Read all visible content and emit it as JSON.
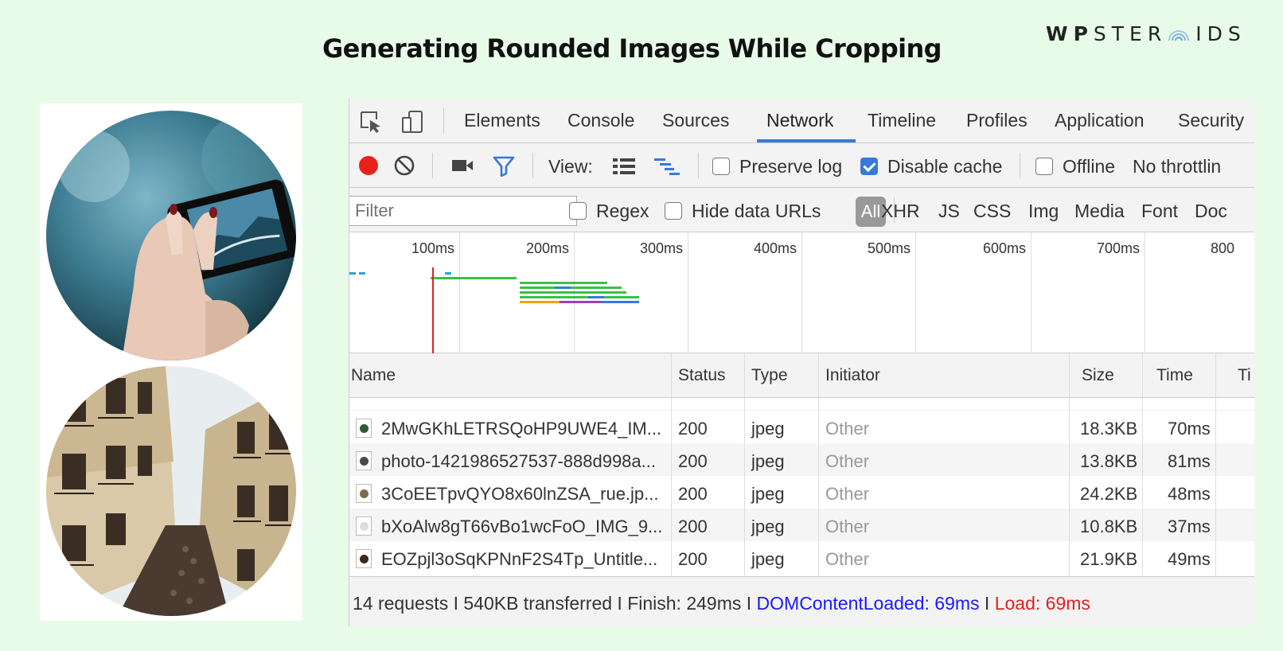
{
  "page_title": "Generating Rounded Images While Cropping",
  "brand": {
    "part1": "WP",
    "part2": "STER",
    "part3": "IDS"
  },
  "devtools": {
    "tabs": [
      {
        "label": "Elements"
      },
      {
        "label": "Console"
      },
      {
        "label": "Sources"
      },
      {
        "label": "Network",
        "active": true
      },
      {
        "label": "Timeline"
      },
      {
        "label": "Profiles"
      },
      {
        "label": "Application"
      },
      {
        "label": "Security"
      }
    ],
    "toolbar": {
      "view_label": "View:",
      "preserve_log": "Preserve log",
      "disable_cache": "Disable cache",
      "offline": "Offline",
      "throttling": "No throttlin"
    },
    "filter": {
      "placeholder": "Filter",
      "regex": "Regex",
      "hide_data_urls": "Hide data URLs",
      "all": "All",
      "types": [
        "XHR",
        "JS",
        "CSS",
        "Img",
        "Media",
        "Font",
        "Doc"
      ]
    },
    "overview_ticks": [
      "100ms",
      "200ms",
      "300ms",
      "400ms",
      "500ms",
      "600ms",
      "700ms",
      "800"
    ],
    "columns": {
      "name": "Name",
      "status": "Status",
      "type": "Type",
      "initiator": "Initiator",
      "size": "Size",
      "time": "Time",
      "timeline": "Ti"
    },
    "rows": [
      {
        "name": "2MwGKhLETRSQoHP9UWE4_IM...",
        "status": "200",
        "type": "jpeg",
        "initiator": "Other",
        "size": "18.3KB",
        "time": "70ms",
        "thumb_color": "#2f5a3a"
      },
      {
        "name": "photo-1421986527537-888d998a...",
        "status": "200",
        "type": "jpeg",
        "initiator": "Other",
        "size": "13.8KB",
        "time": "81ms",
        "thumb_color": "#4a4a4a"
      },
      {
        "name": "3CoEETpvQYO8x60lnZSA_rue.jp...",
        "status": "200",
        "type": "jpeg",
        "initiator": "Other",
        "size": "24.2KB",
        "time": "48ms",
        "thumb_color": "#7a6a50"
      },
      {
        "name": "bXoAlw8gT66vBo1wcFoO_IMG_9...",
        "status": "200",
        "type": "jpeg",
        "initiator": "Other",
        "size": "10.8KB",
        "time": "37ms",
        "thumb_color": "#d8dde0"
      },
      {
        "name": "EOZpjl3oSqKPNnF2S4Tp_Untitle...",
        "status": "200",
        "type": "jpeg",
        "initiator": "Other",
        "size": "21.9KB",
        "time": "49ms",
        "thumb_color": "#3a2a20"
      }
    ],
    "status": {
      "summary": "14 requests I 540KB transferred I Finish: 249ms I ",
      "dcl": "DOMContentLoaded: 69ms",
      "sep": " I ",
      "load": "Load: 69ms"
    },
    "colors": {
      "accent": "#3879d9",
      "record": "#e8221b",
      "dcl": "#1a1aff",
      "load": "#e0201f"
    }
  }
}
